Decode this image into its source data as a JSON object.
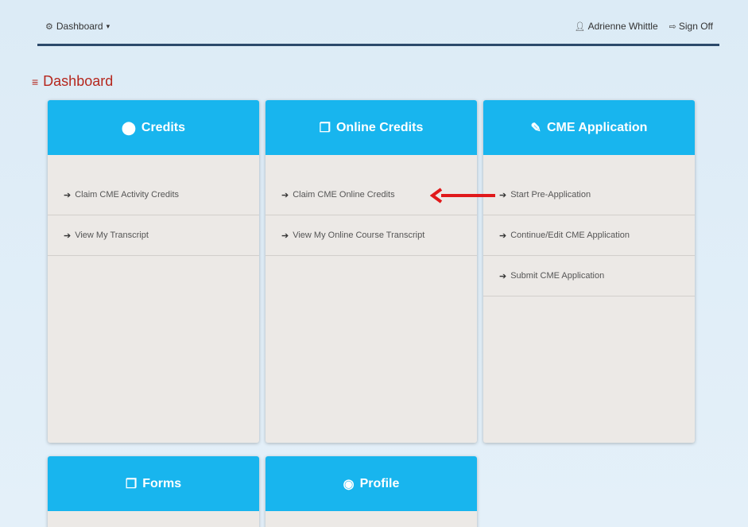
{
  "nav": {
    "dashboard_label": "Dashboard",
    "dropdown_caret": "▾",
    "user_name": "Adrienne Whittle",
    "signoff_label": "Sign Off"
  },
  "page": {
    "title": "Dashboard"
  },
  "cards": [
    {
      "title": "Credits",
      "icon": "circle-icon",
      "links": [
        "Claim CME Activity Credits",
        "View My Transcript"
      ]
    },
    {
      "title": "Online Credits",
      "icon": "copy-icon",
      "links": [
        "Claim CME Online Credits",
        "View My Online Course Transcript"
      ]
    },
    {
      "title": "CME Application",
      "icon": "pencil-icon",
      "links": [
        "Start Pre-Application",
        "Continue/Edit CME Application",
        "Submit CME Application"
      ]
    },
    {
      "title": "Forms",
      "icon": "copy-icon",
      "links": []
    },
    {
      "title": "Profile",
      "icon": "user-circle-icon",
      "links": []
    }
  ],
  "colors": {
    "accent": "#18b5ee",
    "title_red": "#b5271d",
    "annotation_arrow": "#e0191b",
    "topbar_line": "#2c4a6b"
  }
}
